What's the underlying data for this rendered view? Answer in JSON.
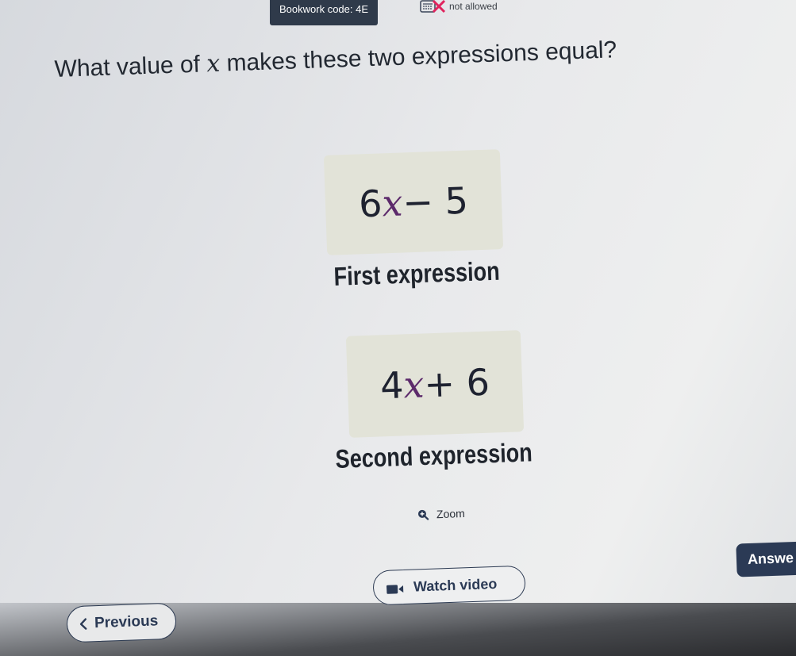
{
  "header": {
    "bookwork_label": "Bookwork code: 4E",
    "calculator_status": "not allowed"
  },
  "question": {
    "prefix": "What value of ",
    "variable": "x",
    "suffix": " makes these two expressions equal?"
  },
  "expressions": [
    {
      "coefficient": "6",
      "variable": "x",
      "rest": "− 5",
      "caption": "First expression"
    },
    {
      "coefficient": "4",
      "variable": "x",
      "rest": "+ 6",
      "caption": "Second expression"
    }
  ],
  "controls": {
    "zoom_label": "Zoom",
    "answer_label": "Answe",
    "watch_video_label": "Watch video",
    "previous_label": "Previous"
  },
  "icons": {
    "zoom": "magnifier-icon",
    "calculator": "calculator-crossed-icon",
    "video": "video-camera-icon",
    "previous": "chevron-left-icon"
  },
  "colors": {
    "accent": "#2b3a55",
    "variable": "#5c2a6b",
    "expression_bg": "#e2e3d8",
    "calc_cross": "#e0245e"
  }
}
